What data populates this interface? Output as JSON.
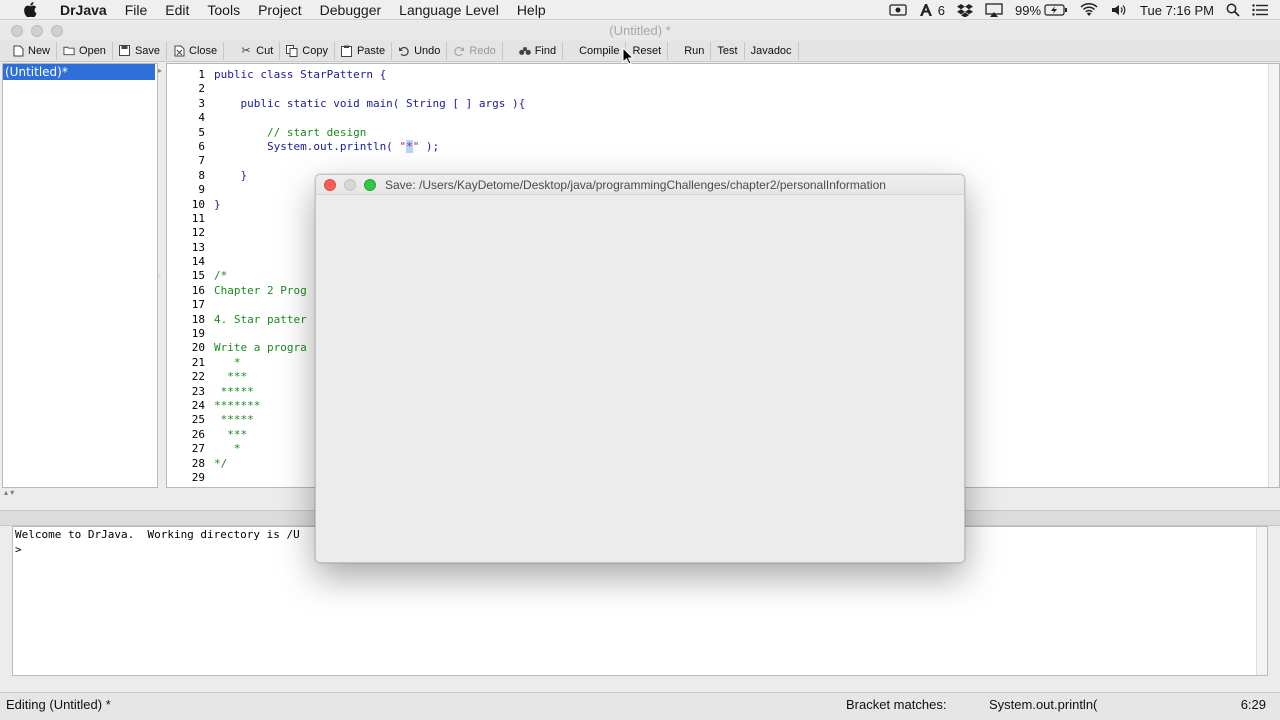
{
  "menubar": {
    "app": "DrJava",
    "items": [
      "File",
      "Edit",
      "Tools",
      "Project",
      "Debugger",
      "Language Level",
      "Help"
    ],
    "status": {
      "notification_count": "6",
      "battery": "99%",
      "clock": "Tue 7:16 PM"
    }
  },
  "window": {
    "title": "(Untitled) *"
  },
  "toolbar": {
    "new": "New",
    "open": "Open",
    "save": "Save",
    "close": "Close",
    "cut": "Cut",
    "copy": "Copy",
    "paste": "Paste",
    "undo": "Undo",
    "redo": "Redo",
    "find": "Find",
    "compile": "Compile",
    "reset": "Reset",
    "run": "Run",
    "test": "Test",
    "javadoc": "Javadoc"
  },
  "documents": {
    "items": [
      "(Untitled)*"
    ]
  },
  "editor": {
    "line_numbers": [
      "1",
      "2",
      "3",
      "4",
      "5",
      "6",
      "7",
      "8",
      "9",
      "10",
      "11",
      "12",
      "13",
      "14",
      "15",
      "16",
      "17",
      "18",
      "19",
      "20",
      "21",
      "22",
      "23",
      "24",
      "25",
      "26",
      "27",
      "28",
      "29"
    ],
    "lines": {
      "l1": "public class StarPattern {",
      "l3": "    public static void main( String [ ] args ){",
      "l5": "        // start design",
      "l6a": "        System.out.println( ",
      "l6q1": "\"",
      "l6sel": "*",
      "l6q2": "\"",
      "l6b": " );",
      "l8": "    }",
      "l10": "}",
      "l15": "/*",
      "l16": "Chapter 2 Prog",
      "l18": "4. Star patter",
      "l20": "Write a progra",
      "l21": "   *",
      "l22": "  ***",
      "l23": " *****",
      "l24": "*******",
      "l25": " *****",
      "l26": "  ***",
      "l27": "   *",
      "l28": "*/"
    }
  },
  "interactions": {
    "welcome": "Welcome to DrJava.  Working directory is /U",
    "prompt": ">"
  },
  "statusbar": {
    "editing": "Editing (Untitled) *",
    "bracket_label": "Bracket matches:",
    "bracket_value": "System.out.println(",
    "position": "6:29"
  },
  "save_dialog": {
    "title": "Save:  /Users/KayDetome/Desktop/java/programmingChallenges/chapter2/personalInformation"
  }
}
